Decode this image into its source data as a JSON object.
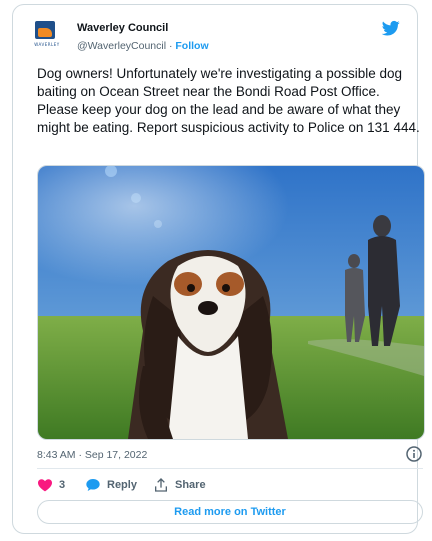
{
  "tweet": {
    "account_name": "Waverley Council",
    "handle": "@WaverleyCouncil",
    "separator": "·",
    "follow_label": "Follow",
    "logo_text": "WAVERLEY",
    "text": "Dog owners! Unfortunately we're investigating a possible dog baiting on Ocean Street near the Bondi Road Post Office.  Please keep your dog on the lead and be aware of what they might be eating. Report suspicious activity to Police on 131 444.",
    "timestamp": "8:43 AM · Sep 17, 2022",
    "likes_count": "3",
    "reply_label": "Reply",
    "share_label": "Share",
    "read_more_label": "Read more on Twitter"
  },
  "colors": {
    "accent": "#1d9bf0",
    "heart": "#f91880",
    "brand_blue": "#1f4f8a",
    "brand_orange": "#f08a24"
  },
  "icons": [
    "twitter-bird-icon",
    "info-icon",
    "heart-icon",
    "reply-icon",
    "share-icon"
  ]
}
